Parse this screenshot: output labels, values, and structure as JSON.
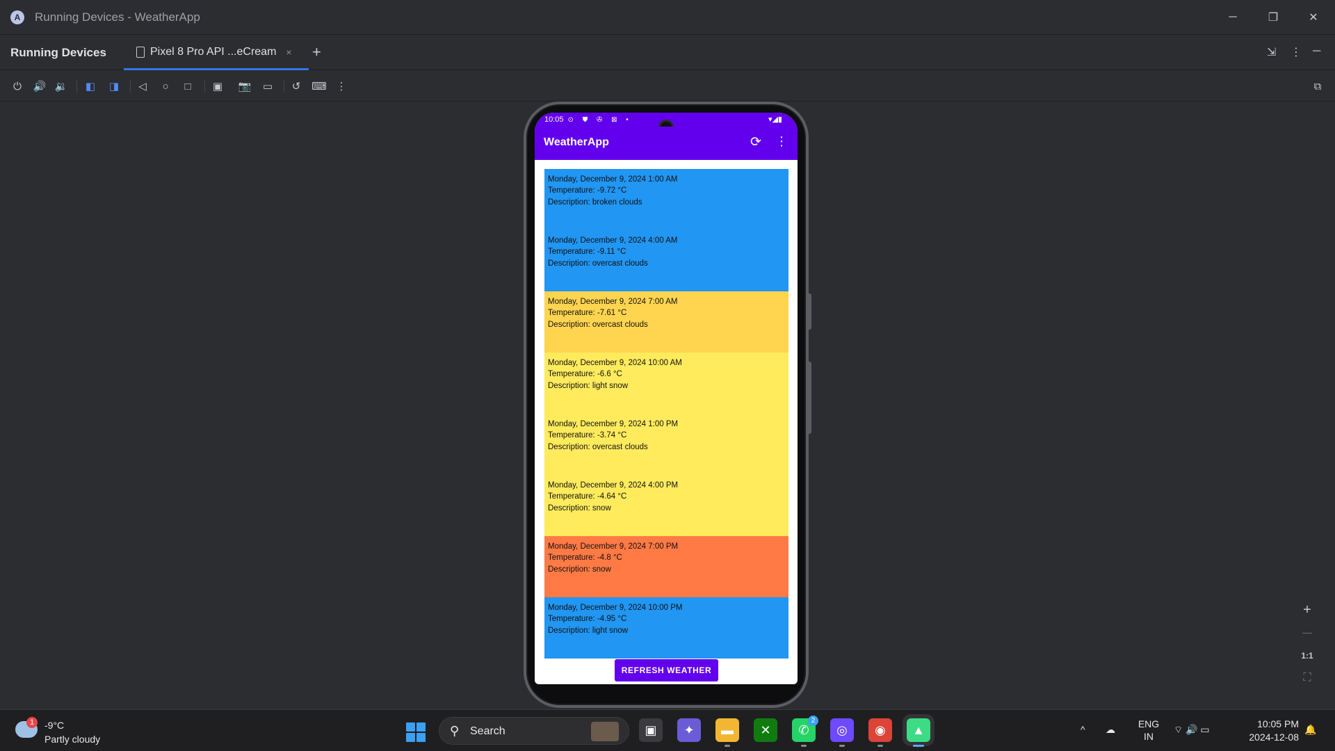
{
  "window": {
    "title": "Running Devices - WeatherApp",
    "minimize_glyph": "─",
    "restore_glyph": "❐",
    "close_glyph": "✕"
  },
  "tool_window": {
    "title": "Running Devices",
    "device_tab_label": "Pixel 8 Pro API ...eCream",
    "tab_close_glyph": "×",
    "add_tab_glyph": "+",
    "right_glyphs": [
      "⇲",
      "⋮",
      "─"
    ]
  },
  "toolbar_icons": [
    "power-icon",
    "volume-up-icon",
    "volume-down-icon",
    "rotate-left-icon",
    "rotate-right-icon",
    "back-icon",
    "home-icon",
    "overview-icon",
    "device-file-icon",
    "screenshot-icon",
    "screen-record-icon",
    "reset-icon",
    "keyboard-icon",
    "more-icon",
    "zoom-search-icon"
  ],
  "toolbar_glyphs": [
    "⏻",
    "🔊",
    "🔉",
    "◧",
    "◨",
    "◁",
    "○",
    "□",
    "▣",
    "📷",
    "▭",
    "↺",
    "⌨",
    "⋮",
    "⧉"
  ],
  "zoom_controls": {
    "plus": "+",
    "minus": "—",
    "one_to_one": "1:1",
    "fit": "⛶"
  },
  "phone": {
    "status_time": "10:05",
    "status_icons": "⊙ ⛊ ✇ ⊠ •",
    "status_right": "▾◢▮",
    "app_title": "WeatherApp",
    "refresh_glyph": "⟳",
    "more_glyph": "⋮",
    "forecasts": [
      {
        "datetime": "Monday, December 9, 2024 1:00 AM",
        "temperature": "Temperature: -9.72 °C",
        "description": "Description: broken clouds",
        "color": "#2196f3"
      },
      {
        "datetime": "Monday, December 9, 2024 4:00 AM",
        "temperature": "Temperature: -9.11 °C",
        "description": "Description: overcast clouds",
        "color": "#2196f3"
      },
      {
        "datetime": "Monday, December 9, 2024 7:00 AM",
        "temperature": "Temperature: -7.61 °C",
        "description": "Description: overcast clouds",
        "color": "#ffd54f"
      },
      {
        "datetime": "Monday, December 9, 2024 10:00 AM",
        "temperature": "Temperature: -6.6 °C",
        "description": "Description: light snow",
        "color": "#ffeb5c"
      },
      {
        "datetime": "Monday, December 9, 2024 1:00 PM",
        "temperature": "Temperature: -3.74 °C",
        "description": "Description: overcast clouds",
        "color": "#ffeb5c"
      },
      {
        "datetime": "Monday, December 9, 2024 4:00 PM",
        "temperature": "Temperature: -4.64 °C",
        "description": "Description: snow",
        "color": "#ffeb5c"
      },
      {
        "datetime": "Monday, December 9, 2024 7:00 PM",
        "temperature": "Temperature: -4.8 °C",
        "description": "Description: snow",
        "color": "#ff7a45"
      },
      {
        "datetime": "Monday, December 9, 2024 10:00 PM",
        "temperature": "Temperature: -4.95 °C",
        "description": "Description: light snow",
        "color": "#2196f3"
      }
    ],
    "refresh_button": "REFRESH WEATHER"
  },
  "taskbar": {
    "weather_badge": "1",
    "weather_temp": "-9°C",
    "weather_desc": "Partly cloudy",
    "search_label": "Search",
    "search_glyph": "⚲",
    "apps": [
      {
        "name": "task-view-icon",
        "glyph": "▣",
        "bg": "#3b3b3f"
      },
      {
        "name": "copilot-icon",
        "glyph": "✦",
        "bg": "#6b5cd6"
      },
      {
        "name": "file-explorer-icon",
        "glyph": "▬",
        "bg": "#f2b632"
      },
      {
        "name": "xbox-icon",
        "glyph": "✕",
        "bg": "#107c10"
      },
      {
        "name": "whatsapp-icon",
        "glyph": "✆",
        "bg": "#25d366",
        "badge": "2"
      },
      {
        "name": "proton-icon",
        "glyph": "◎",
        "bg": "#6d4aff"
      },
      {
        "name": "chrome-icon",
        "glyph": "◉",
        "bg": "#db4437"
      },
      {
        "name": "android-studio-icon",
        "glyph": "▲",
        "bg": "#3ddc84"
      }
    ],
    "tray_chevron": "^",
    "tray_cloud": "☁",
    "tray_icons": "⌔ 🔊 ▭",
    "lang_primary": "ENG",
    "lang_secondary": "IN",
    "time": "10:05 PM",
    "date": "2024-12-08",
    "notification_glyph": "🔔"
  }
}
